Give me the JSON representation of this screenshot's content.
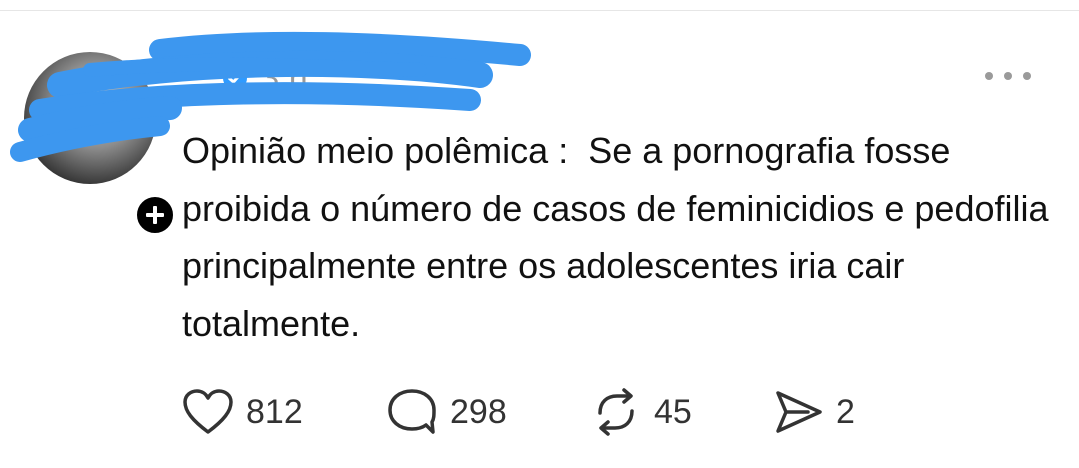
{
  "post": {
    "username": "...",
    "timestamp": "3 h",
    "text": "Opinião meio polêmica :  Se a pornografia fosse proibida o número de casos de feminicidios e pedofilia principalmente entre os adolescentes iria cair totalmente.",
    "actions": {
      "likes": "812",
      "replies": "298",
      "reposts": "45",
      "shares": "2"
    }
  },
  "icons": {
    "follow": "plus-icon",
    "verified": "verified-badge-icon",
    "more": "more-options-icon",
    "like": "heart-icon",
    "reply": "comment-bubble-icon",
    "repost": "repost-icon",
    "share": "share-send-icon"
  },
  "colors": {
    "background": "#ffffff",
    "text": "#111111",
    "muted": "#9a9a9a",
    "redaction": "#3d97ef",
    "verified": "#2f9bff"
  }
}
